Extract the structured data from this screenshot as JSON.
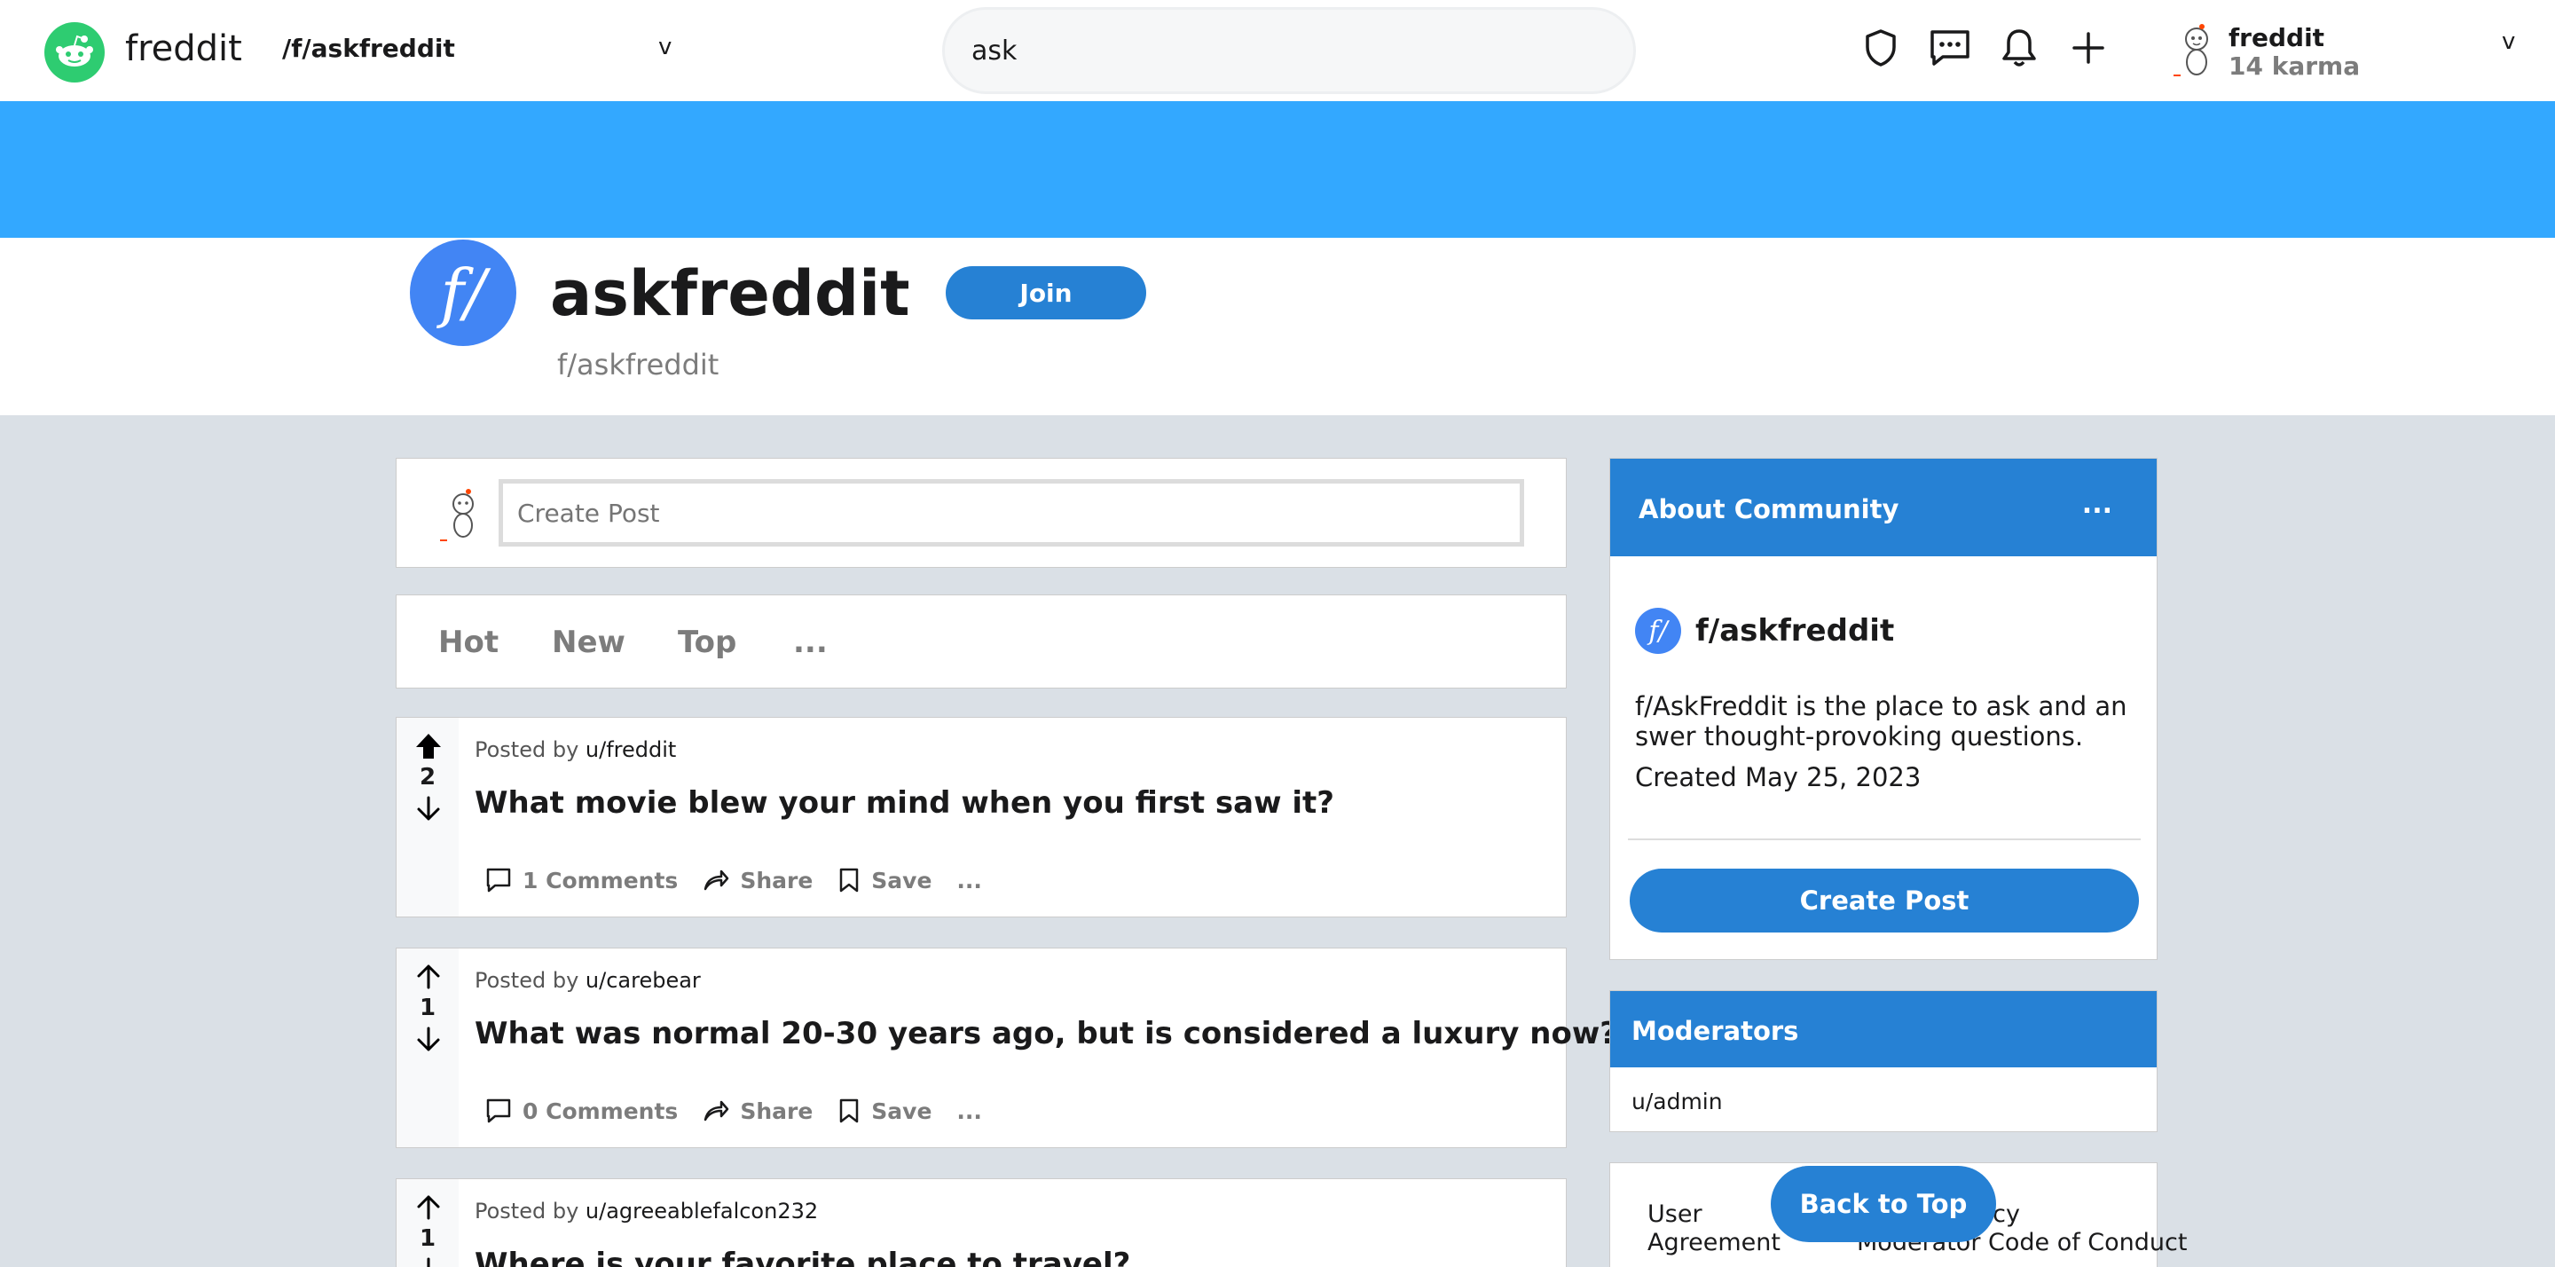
{
  "header": {
    "brand": "freddit",
    "subreddit_selector": "/f/askfreddit",
    "subreddit_chevron": "v",
    "search_value": "ask",
    "icons": [
      "shield-icon",
      "chat-icon",
      "bell-icon",
      "plus-icon"
    ],
    "user": {
      "name": "freddit",
      "karma": "14 karma",
      "chevron": "v"
    }
  },
  "subreddit": {
    "icon_text": "f/",
    "title": "askfreddit",
    "handle": "f/askfreddit",
    "join_label": "Join",
    "banner_color": "#33a8ff"
  },
  "create_post": {
    "placeholder": "Create Post"
  },
  "sort_tabs": [
    "Hot",
    "New",
    "Top",
    "..."
  ],
  "posts": [
    {
      "posted_prefix": "Posted by",
      "author": "u/freddit",
      "votes": "2",
      "upvoted": true,
      "title": "What movie blew your mind when you first saw it?",
      "comments": "1 Comments",
      "share": "Share",
      "save": "Save",
      "more": "..."
    },
    {
      "posted_prefix": "Posted by",
      "author": "u/carebear",
      "votes": "1",
      "upvoted": false,
      "title": "What was normal 20-30 years ago, but is considered a luxury now?",
      "comments": "0 Comments",
      "share": "Share",
      "save": "Save",
      "more": "..."
    },
    {
      "posted_prefix": "Posted by",
      "author": "u/agreeablefalcon232",
      "votes": "1",
      "upvoted": false,
      "title": "Where is your favorite place to travel?",
      "comments": "",
      "share": "",
      "save": "",
      "more": ""
    }
  ],
  "sidebar": {
    "about": {
      "header": "About Community",
      "menu": "...",
      "icon_text": "f/",
      "name": "f/askfreddit",
      "description": "f/AskFreddit is the place to ask and answer thought-provoking questions.",
      "created": "Created May 25, 2023",
      "create_post_label": "Create Post"
    },
    "moderators": {
      "header": "Moderators",
      "users": [
        "u/admin"
      ]
    },
    "links": {
      "user_agreement": "User Agreement",
      "privacy": "Privacy Policy",
      "moderator_code": "Moderator Code of Conduct"
    },
    "back_to_top": "Back to Top"
  },
  "colors": {
    "accent": "#2681d4",
    "brand_green": "#2ecc71",
    "page_bg": "#dae0e6"
  }
}
